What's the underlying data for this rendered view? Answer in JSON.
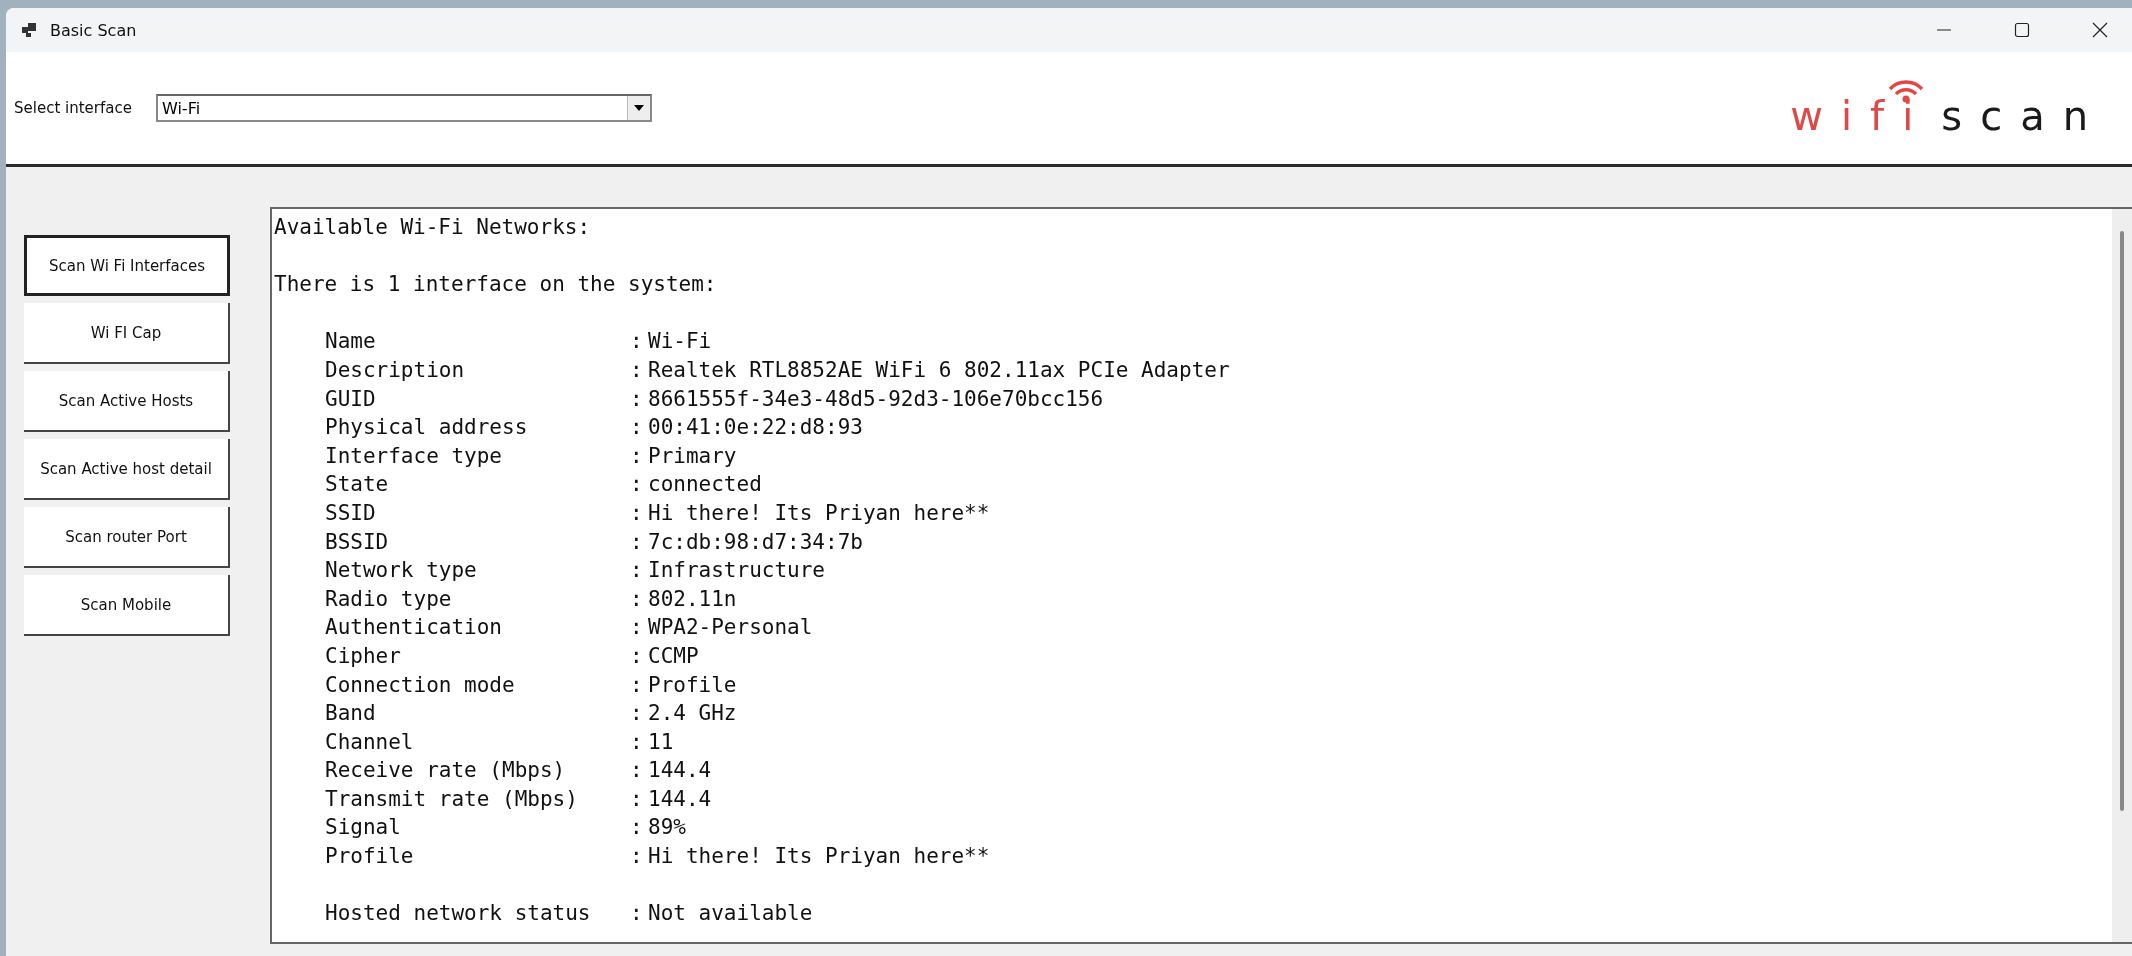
{
  "window": {
    "title": "Basic Scan"
  },
  "interface_select": {
    "label": "Select interface",
    "value": "Wi-Fi"
  },
  "logo": {
    "part_1": "wifi",
    "part_2": "scan"
  },
  "buttons": [
    {
      "label": "Scan Wi Fi Interfaces",
      "selected": true
    },
    {
      "label": "Wi FI Cap",
      "selected": false
    },
    {
      "label": "Scan Active Hosts",
      "selected": false
    },
    {
      "label": "Scan Active host detail",
      "selected": false
    },
    {
      "label": "Scan router Port",
      "selected": false
    },
    {
      "label": "Scan Mobile",
      "selected": false
    }
  ],
  "output": {
    "heading": "Available Wi-Fi Networks:",
    "summary": "There is 1 interface on the system:",
    "separator": ":",
    "fields": [
      {
        "label": "Name",
        "value": "Wi-Fi"
      },
      {
        "label": "Description",
        "value": "Realtek RTL8852AE WiFi 6 802.11ax PCIe Adapter"
      },
      {
        "label": "GUID",
        "value": "8661555f-34e3-48d5-92d3-106e70bcc156"
      },
      {
        "label": "Physical address",
        "value": "00:41:0e:22:d8:93"
      },
      {
        "label": "Interface type",
        "value": "Primary"
      },
      {
        "label": "State",
        "value": "connected"
      },
      {
        "label": "SSID",
        "value": "Hi there! Its Priyan here**"
      },
      {
        "label": "BSSID",
        "value": "7c:db:98:d7:34:7b"
      },
      {
        "label": "Network type",
        "value": "Infrastructure"
      },
      {
        "label": "Radio type",
        "value": "802.11n"
      },
      {
        "label": "Authentication",
        "value": "WPA2-Personal"
      },
      {
        "label": "Cipher",
        "value": "CCMP"
      },
      {
        "label": "Connection mode",
        "value": "Profile"
      },
      {
        "label": "Band",
        "value": "2.4 GHz"
      },
      {
        "label": "Channel",
        "value": "11"
      },
      {
        "label": "Receive rate (Mbps)",
        "value": "144.4"
      },
      {
        "label": "Transmit rate (Mbps)",
        "value": "144.4"
      },
      {
        "label": "Signal",
        "value": "89%"
      },
      {
        "label": "Profile",
        "value": "Hi there! Its Priyan here**"
      }
    ],
    "fields_2": [
      {
        "label": "Hosted network status",
        "value": "Not available"
      }
    ]
  }
}
